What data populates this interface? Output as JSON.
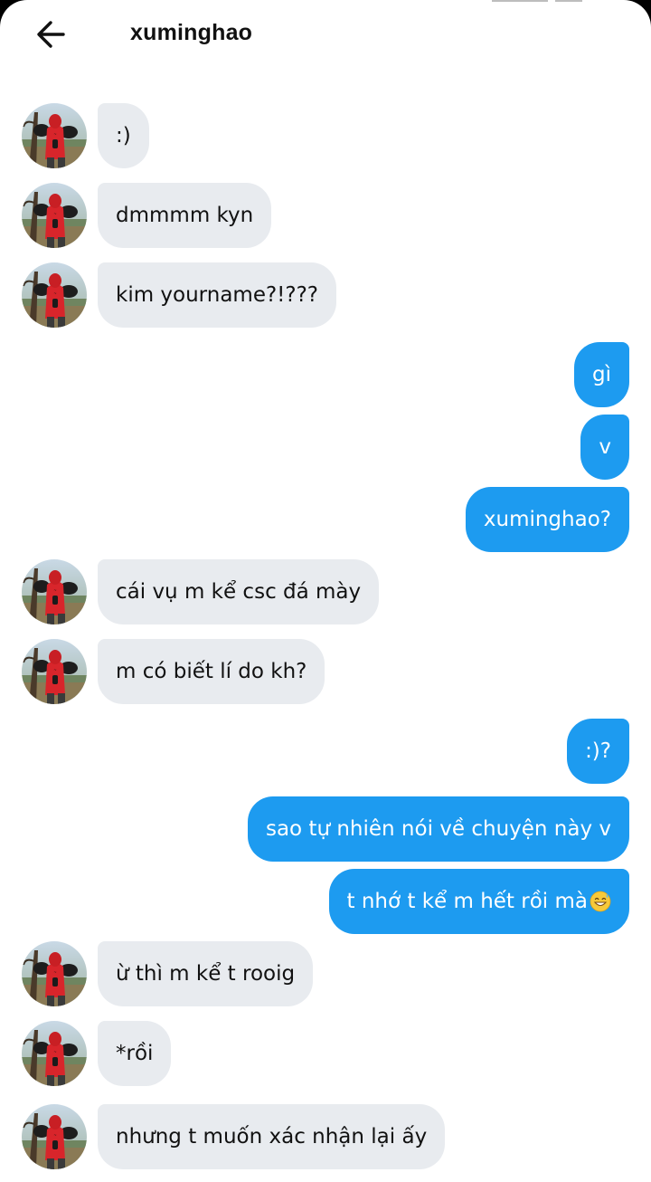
{
  "header": {
    "title": "xuminghao",
    "back_icon": "arrow-left-icon"
  },
  "colors": {
    "incoming_bubble": "#e8ebef",
    "outgoing_bubble": "#1d9bf0",
    "outgoing_text": "#ffffff",
    "incoming_text": "#111111"
  },
  "messages": [
    {
      "side": "in",
      "text": ":)"
    },
    {
      "side": "in",
      "text": "dmmmm kyn"
    },
    {
      "side": "in",
      "text": "kim yourname?!???"
    },
    {
      "side": "out",
      "text": "gì"
    },
    {
      "side": "out",
      "text": "v"
    },
    {
      "side": "out",
      "text": "xuminghao?"
    },
    {
      "side": "in",
      "text": "cái vụ m kể csc đá mày"
    },
    {
      "side": "in",
      "text": "m có biết lí do kh?"
    },
    {
      "side": "out",
      "text": ":)?"
    },
    {
      "side": "out",
      "text": "sao tự nhiên nói về chuyện này v"
    },
    {
      "side": "out",
      "text": "t nhớ t kể m hết rồi mà",
      "emoji": "grinning-sweat-emoji"
    },
    {
      "side": "in",
      "text": "ừ thì m kể t rooig"
    },
    {
      "side": "in",
      "text": "*rồi"
    },
    {
      "side": "in",
      "text": "nhưng t muốn xác nhận lại ấy"
    }
  ]
}
